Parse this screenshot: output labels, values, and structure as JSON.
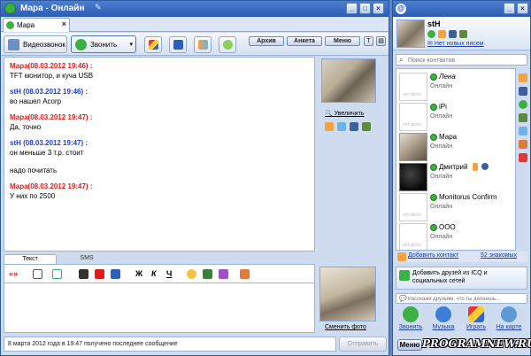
{
  "chat_window": {
    "title": "Мара - Онлайн",
    "tab_label": "Мара",
    "toolbar": {
      "video_call": "Видеозвонок",
      "call": "Звонить",
      "archive": "Архив",
      "profile": "Анкета",
      "menu": "Меню"
    },
    "messages": [
      {
        "header": "Мара(08.03.2012 19:46) :",
        "color": "#e01b1b",
        "body": "TFT монитор, и куча USB"
      },
      {
        "header": "stH (08.03.2012 19:46) :",
        "color": "#1f3fd0",
        "body": "во нашел Acorp"
      },
      {
        "header": "Мара(08.03.2012 19:47) :",
        "color": "#e01b1b",
        "body": "Да, точно"
      },
      {
        "header": "stH (08.03.2012 19:47) :",
        "color": "#1f3fd0",
        "body": "он меньше 3 т.р. стоит"
      },
      {
        "header": "",
        "color": "#000000",
        "body": "надо почитать"
      },
      {
        "header": "Мара(08.03.2012 19:47) :",
        "color": "#e01b1b",
        "body": "У них по 2500"
      }
    ],
    "enlarge": "Увеличить",
    "editor_tabs": {
      "text": "Текст",
      "sms": "SMS"
    },
    "format": {
      "arrows": "«»",
      "bold": "Ж",
      "italic": "К",
      "underline": "Ч"
    },
    "change_photo": "Сменить фото",
    "status_line": "8 марта 2012 года в 19:47 получено последнее сообщение",
    "send": "Отправить"
  },
  "contact_list": {
    "my_name": "stH",
    "no_mail": "Нет новых писем",
    "search_placeholder": "Поиск контактов",
    "contacts": [
      {
        "name": "Лена",
        "status": "Онлайн",
        "no_photo": "нет фото"
      },
      {
        "name": "iPi",
        "status": "Онлайн",
        "no_photo": "нет фото"
      },
      {
        "name": "Мара",
        "status": "Онлайн",
        "no_photo": ""
      },
      {
        "name": "Дмитрий",
        "status": "Онлайн",
        "no_photo": ""
      },
      {
        "name": "Monitorus Confirm",
        "status": "Онлайн",
        "no_photo": "нет фото"
      },
      {
        "name": "ООО",
        "status": "Онлайн",
        "no_photo": "нет фото"
      }
    ],
    "add_contact": "Добавить контакт",
    "count": "52 знакомых",
    "promo": "Добавить друзей из ICQ и социальных сетей",
    "status_placeholder": "Расскажи друзьям, что ты делаешь...",
    "quick_actions": [
      "Звонить",
      "Музыка",
      "Играть",
      "На карте"
    ],
    "menu": "Меню"
  },
  "watermark": "PROGRAMNEW.RU"
}
